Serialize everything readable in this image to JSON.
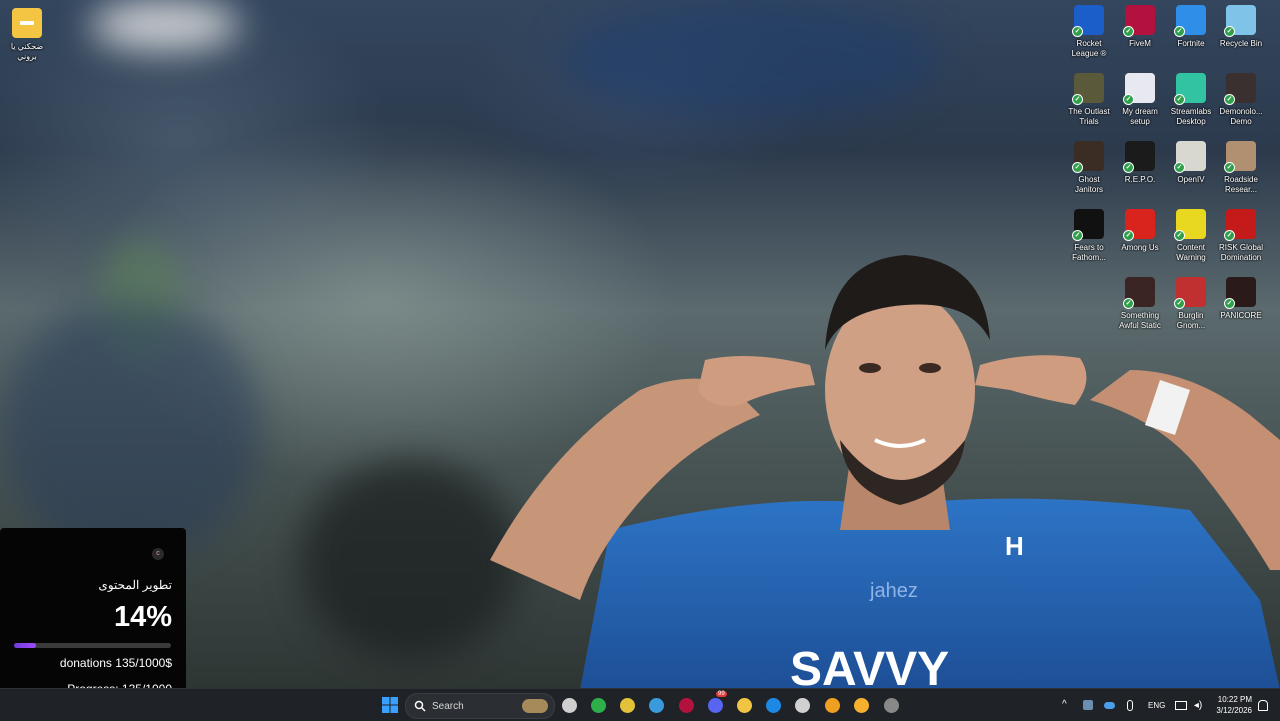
{
  "desktop": {
    "left_icon": {
      "label": "ضحكني يا\nبروني",
      "icon": "folder-icon"
    },
    "icons": [
      {
        "label": "Rocket\nLeague ®",
        "icon": "rocket-league-icon",
        "color": "#1c5ec9"
      },
      {
        "label": "FiveM",
        "icon": "fivem-icon",
        "color": "#b3123f"
      },
      {
        "label": "Fortnite",
        "icon": "fortnite-icon",
        "color": "#2f8fe8"
      },
      {
        "label": "Recycle Bin",
        "icon": "recycle-bin-icon",
        "color": "#7fc4e8"
      },
      {
        "label": "The Outlast\nTrials",
        "icon": "outlast-trials-icon",
        "color": "#5a5a3a"
      },
      {
        "label": "My dream\nsetup",
        "icon": "my-dream-setup-icon",
        "color": "#e8e8f0"
      },
      {
        "label": "Streamlabs\nDesktop",
        "icon": "streamlabs-icon",
        "color": "#31c3a2"
      },
      {
        "label": "Demonolo...\nDemo",
        "icon": "demonologist-icon",
        "color": "#3a3030"
      },
      {
        "label": "Ghost\nJanitors",
        "icon": "ghost-janitors-icon",
        "color": "#3b2c24"
      },
      {
        "label": "R.E.P.O.",
        "icon": "repo-icon",
        "color": "#1b1b1b"
      },
      {
        "label": "OpenIV",
        "icon": "openiv-icon",
        "color": "#d8d8d0"
      },
      {
        "label": "Roadside\nResear...",
        "icon": "roadside-research-icon",
        "color": "#b09070"
      },
      {
        "label": "Fears to\nFathom...",
        "icon": "fears-to-fathom-icon",
        "color": "#111"
      },
      {
        "label": "Among Us",
        "icon": "among-us-icon",
        "color": "#d9241e"
      },
      {
        "label": "Content\nWarning",
        "icon": "content-warning-icon",
        "color": "#e8d820"
      },
      {
        "label": "RISK Global\nDomination",
        "icon": "risk-icon",
        "color": "#c41a1a"
      },
      {
        "label": "Something\nAwful Static",
        "icon": "something-awful-static-icon",
        "color": "#3a2424"
      },
      {
        "label": "Burglin\nGnom...",
        "icon": "burglin-gnomes-icon",
        "color": "#c03030"
      },
      {
        "label": "PANICORE",
        "icon": "panicore-icon",
        "color": "#2a1a1a"
      }
    ]
  },
  "widget": {
    "title": "تطوير المحتوى",
    "percent": "14%",
    "progress_fraction": 0.14,
    "donations": "donations 135/1000$",
    "progress": "Progress: 135/1000"
  },
  "taskbar": {
    "search_placeholder": "Search",
    "apps": [
      {
        "name": "file-explorer-icon"
      },
      {
        "name": "chrome-icon"
      },
      {
        "name": "chrome-dev-icon"
      },
      {
        "name": "copilot-icon"
      },
      {
        "name": "fivem-icon"
      },
      {
        "name": "discord-icon"
      },
      {
        "name": "folder-icon"
      },
      {
        "name": "edge-icon"
      },
      {
        "name": "store-icon"
      },
      {
        "name": "brave-icon"
      },
      {
        "name": "app-notification-icon"
      },
      {
        "name": "steam-icon"
      }
    ],
    "discord_badge": "99",
    "tray": {
      "lang": "ENG",
      "time": "10:22 PM",
      "date": "3/12/2026"
    }
  }
}
